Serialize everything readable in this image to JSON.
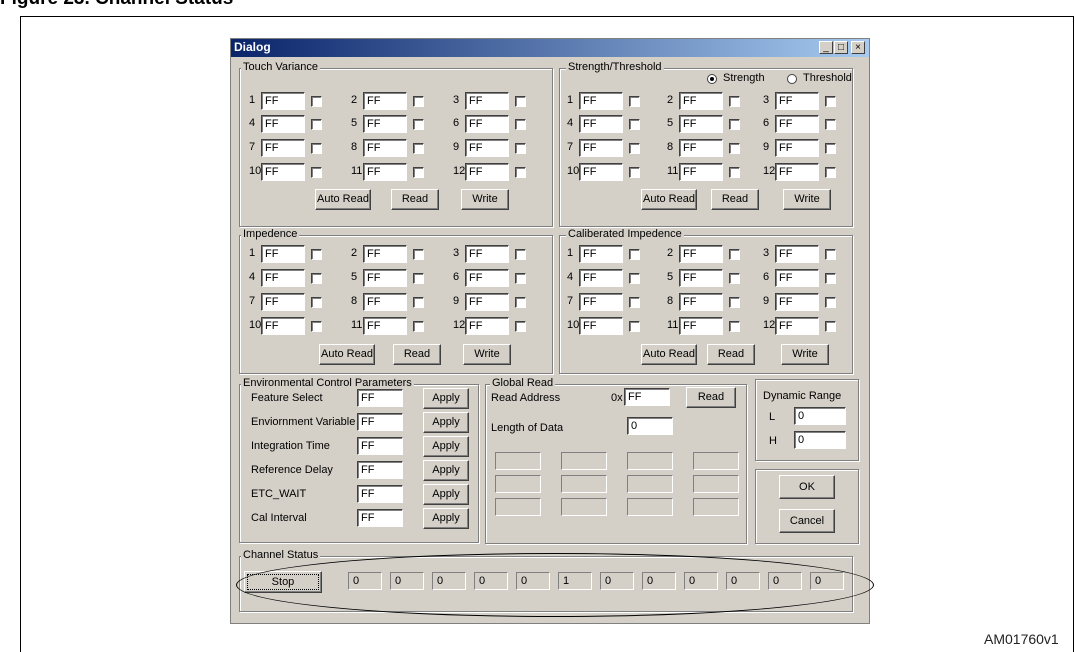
{
  "figure": {
    "heading": "Figure 23.   Channel Status",
    "code": "AM01760v1"
  },
  "dialog": {
    "title": "Dialog",
    "titlebar_buttons": {
      "minimize": "_",
      "maximize": "□",
      "close": "×"
    },
    "touch_variance": {
      "label": "Touch Variance",
      "channels": [
        {
          "num": "1",
          "value": "FF"
        },
        {
          "num": "2",
          "value": "FF"
        },
        {
          "num": "3",
          "value": "FF"
        },
        {
          "num": "4",
          "value": "FF"
        },
        {
          "num": "5",
          "value": "FF"
        },
        {
          "num": "6",
          "value": "FF"
        },
        {
          "num": "7",
          "value": "FF"
        },
        {
          "num": "8",
          "value": "FF"
        },
        {
          "num": "9",
          "value": "FF"
        },
        {
          "num": "10",
          "value": "FF"
        },
        {
          "num": "11",
          "value": "FF"
        },
        {
          "num": "12",
          "value": "FF"
        }
      ],
      "buttons": {
        "auto_read": "Auto Read",
        "read": "Read",
        "write": "Write"
      }
    },
    "strength_threshold": {
      "label": "Strength/Threshold",
      "radio": {
        "strength": "Strength",
        "threshold": "Threshold",
        "selected": "Strength"
      },
      "channels": [
        {
          "num": "1",
          "value": "FF"
        },
        {
          "num": "2",
          "value": "FF"
        },
        {
          "num": "3",
          "value": "FF"
        },
        {
          "num": "4",
          "value": "FF"
        },
        {
          "num": "5",
          "value": "FF"
        },
        {
          "num": "6",
          "value": "FF"
        },
        {
          "num": "7",
          "value": "FF"
        },
        {
          "num": "8",
          "value": "FF"
        },
        {
          "num": "9",
          "value": "FF"
        },
        {
          "num": "10",
          "value": "FF"
        },
        {
          "num": "11",
          "value": "FF"
        },
        {
          "num": "12",
          "value": "FF"
        }
      ],
      "buttons": {
        "auto_read": "Auto Read",
        "read": "Read",
        "write": "Write"
      }
    },
    "impedence": {
      "label": "Impedence",
      "channels": [
        {
          "num": "1",
          "value": "FF"
        },
        {
          "num": "2",
          "value": "FF"
        },
        {
          "num": "3",
          "value": "FF"
        },
        {
          "num": "4",
          "value": "FF"
        },
        {
          "num": "5",
          "value": "FF"
        },
        {
          "num": "6",
          "value": "FF"
        },
        {
          "num": "7",
          "value": "FF"
        },
        {
          "num": "8",
          "value": "FF"
        },
        {
          "num": "9",
          "value": "FF"
        },
        {
          "num": "10",
          "value": "FF"
        },
        {
          "num": "11",
          "value": "FF"
        },
        {
          "num": "12",
          "value": "FF"
        }
      ],
      "buttons": {
        "auto_read": "Auto Read",
        "read": "Read",
        "write": "Write"
      }
    },
    "calibrated_impedence": {
      "label": "Caliberated Impedence",
      "channels": [
        {
          "num": "1",
          "value": "FF"
        },
        {
          "num": "2",
          "value": "FF"
        },
        {
          "num": "3",
          "value": "FF"
        },
        {
          "num": "4",
          "value": "FF"
        },
        {
          "num": "5",
          "value": "FF"
        },
        {
          "num": "6",
          "value": "FF"
        },
        {
          "num": "7",
          "value": "FF"
        },
        {
          "num": "8",
          "value": "FF"
        },
        {
          "num": "9",
          "value": "FF"
        },
        {
          "num": "10",
          "value": "FF"
        },
        {
          "num": "11",
          "value": "FF"
        },
        {
          "num": "12",
          "value": "FF"
        }
      ],
      "buttons": {
        "auto_read": "Auto Read",
        "read": "Read",
        "write": "Write"
      }
    },
    "environmental": {
      "label": "Environmental Control Parameters",
      "apply_label": "Apply",
      "rows": [
        {
          "label": "Feature Select",
          "value": "FF"
        },
        {
          "label": "Enviornment Variable",
          "value": "FF"
        },
        {
          "label": "Integration Time",
          "value": "FF"
        },
        {
          "label": "Reference Delay",
          "value": "FF"
        },
        {
          "label": "ETC_WAIT",
          "value": "FF"
        },
        {
          "label": "Cal Interval",
          "value": "FF"
        }
      ]
    },
    "global_read": {
      "label": "Global Read",
      "read_address_label": "Read Address",
      "hex_prefix": "0x",
      "address_value": "FF",
      "read_button": "Read",
      "length_label": "Length of Data",
      "length_value": "0"
    },
    "dynamic_range": {
      "label": "Dynamic Range",
      "l_label": "L",
      "l_value": "0",
      "h_label": "H",
      "h_value": "0"
    },
    "ok_label": "OK",
    "cancel_label": "Cancel",
    "channel_status": {
      "label": "Channel Status",
      "stop_label": "Stop",
      "values": [
        "0",
        "0",
        "0",
        "0",
        "0",
        "1",
        "0",
        "0",
        "0",
        "0",
        "0",
        "0"
      ]
    }
  }
}
